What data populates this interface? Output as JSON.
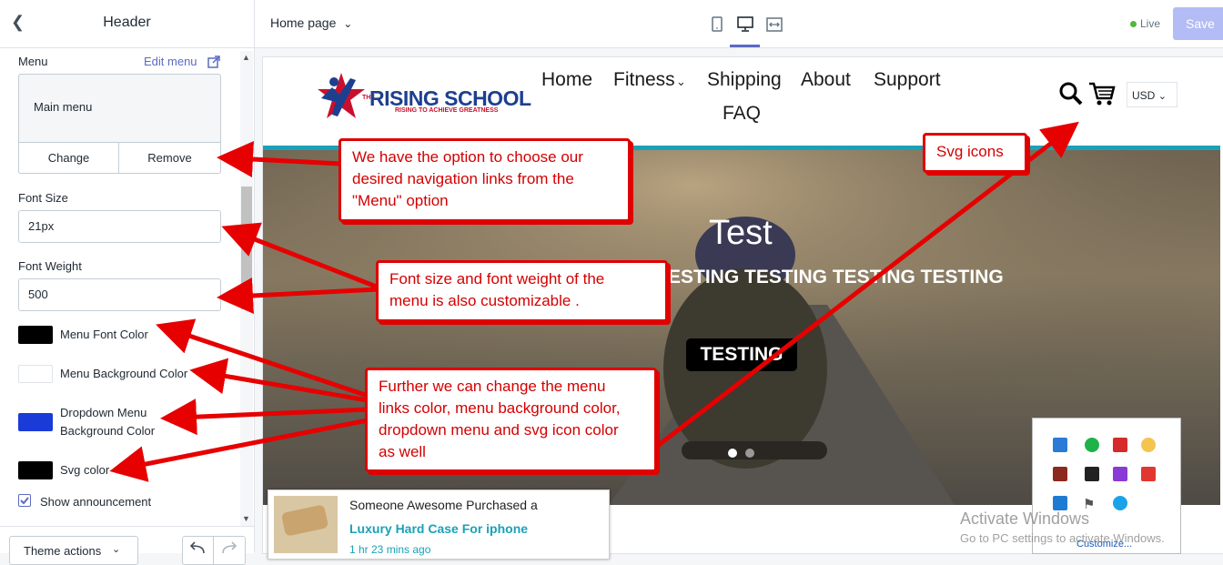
{
  "sidebar": {
    "title": "Header",
    "menu": {
      "label": "Menu",
      "edit_link": "Edit menu",
      "current": "Main menu",
      "change_label": "Change",
      "remove_label": "Remove"
    },
    "font_size": {
      "label": "Font Size",
      "value": "21px"
    },
    "font_weight": {
      "label": "Font Weight",
      "value": "500"
    },
    "colors": [
      {
        "label": "Menu Font Color",
        "color": "#000000"
      },
      {
        "label": "Menu Background Color",
        "color": "#ffffff"
      },
      {
        "label_line1": "Dropdown Menu",
        "label_line2": "Background Color",
        "color": "#1a3bd8"
      },
      {
        "label": "Svg color",
        "color": "#000000"
      }
    ],
    "announcement": {
      "label": "Show announcement",
      "checked": true
    },
    "footer": {
      "theme_actions": "Theme actions"
    }
  },
  "topbar": {
    "page_select": "Home page",
    "live_label": "Live",
    "save_label": "Save"
  },
  "preview": {
    "logo": {
      "title": "RISING SCHOOL",
      "prefix": "THE",
      "tagline": "RISING TO ACHIEVE GREATNESS"
    },
    "nav": [
      "Home",
      "Fitness",
      "Shipping",
      "About",
      "Support",
      "FAQ"
    ],
    "currency": "USD",
    "hero": {
      "title": "Test",
      "subtitle": "ESTING TESTING TESTING TESTING",
      "button": "TESTING"
    },
    "popup": {
      "line1": "Someone Awesome Purchased a",
      "product": "Luxury Hard Case For iphone",
      "time": "1 hr 23 mins ago"
    }
  },
  "annotations": {
    "menu": [
      "We have the option to choose our",
      "desired navigation links from the",
      "\"Menu\" option"
    ],
    "font": [
      "Font size and font weight of the",
      "menu is also customizable ."
    ],
    "colors": [
      "Further we can change the menu",
      "links color, menu background color,",
      "dropdown menu and svg icon color",
      "as well"
    ],
    "svg": [
      "Svg icons"
    ]
  },
  "tray": {
    "customize": "Customize..."
  },
  "watermark": {
    "line1": "Activate Windows",
    "line2": "Go to PC settings to activate Windows."
  }
}
